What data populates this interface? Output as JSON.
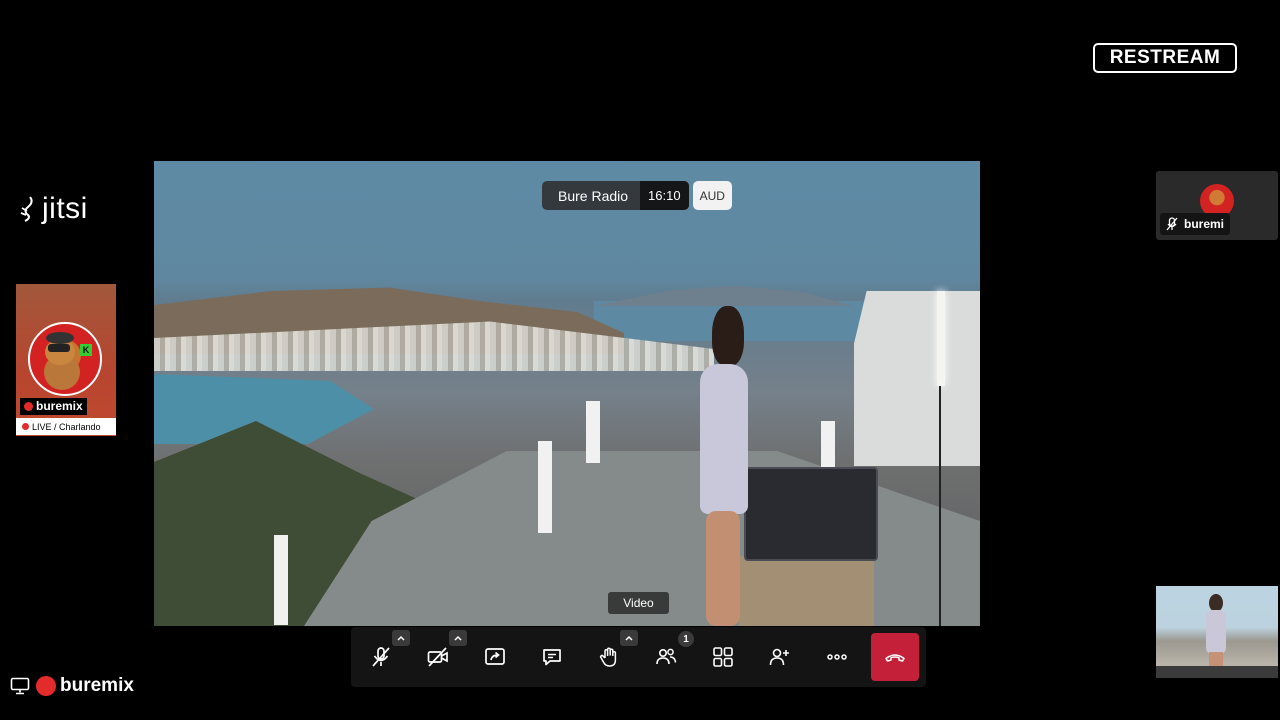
{
  "brand": {
    "restream_label": "RESTREAM",
    "jitsi_label": "jitsi"
  },
  "left_participant": {
    "name": "buremix",
    "status": "LIVE / Charlando",
    "live_color": "#e32b2b"
  },
  "main_stage": {
    "stream_title": "Bure Radio",
    "elapsed_time": "16:10",
    "badge": "AUD",
    "source_label": "Video"
  },
  "right_participant": {
    "name": "buremi",
    "muted": true
  },
  "toolbar": {
    "buttons": [
      {
        "name": "microphone",
        "icon": "mic-off-icon",
        "muted": true,
        "has_menu": true
      },
      {
        "name": "camera",
        "icon": "camera-off-icon",
        "muted": true,
        "has_menu": true
      },
      {
        "name": "share-screen",
        "icon": "share-screen-icon"
      },
      {
        "name": "chat",
        "icon": "chat-icon"
      },
      {
        "name": "raise-hand",
        "icon": "raise-hand-icon",
        "has_menu": true
      },
      {
        "name": "participants",
        "icon": "participants-icon",
        "badge": "1"
      },
      {
        "name": "tile-view",
        "icon": "tile-view-icon"
      },
      {
        "name": "invite",
        "icon": "add-person-icon"
      },
      {
        "name": "more",
        "icon": "more-icon"
      },
      {
        "name": "hangup",
        "icon": "hangup-icon",
        "color": "#c5203a"
      }
    ]
  },
  "local_user": {
    "name": "buremix",
    "icon": "monitor-icon"
  },
  "colors": {
    "background": "#000000",
    "hangup": "#c5203a",
    "live_dot": "#e32b2b",
    "toolbar": "#141414"
  }
}
